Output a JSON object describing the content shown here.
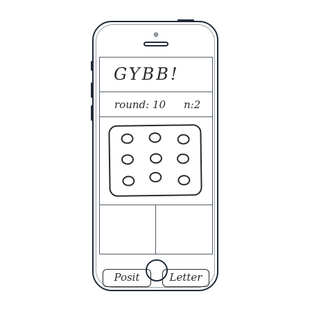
{
  "app": {
    "title": "GYBB!"
  },
  "status": {
    "round_label": "round: 10",
    "n_label": "n:2"
  },
  "board": {
    "rows": 3,
    "cols": 3
  },
  "controls": {
    "position_button": "Posit",
    "letter_button": "Letter"
  },
  "colors": {
    "outline": "#1f2a3a",
    "sketch": "#2a2a2a",
    "background": "#ffffff"
  }
}
